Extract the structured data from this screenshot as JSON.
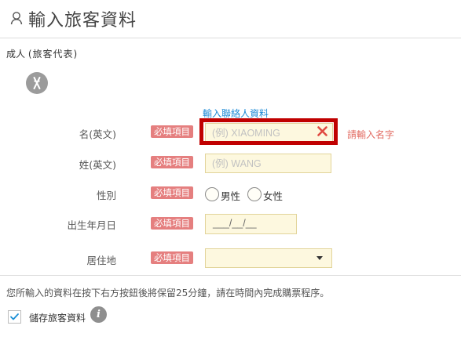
{
  "header": {
    "title": "輸入旅客資料",
    "icon": "person-icon"
  },
  "section": {
    "title": "成人",
    "subtitle": "(旅客代表)"
  },
  "contact_link": "輸入聯絡人資料",
  "required_badge": "必填項目",
  "form": {
    "name_en": {
      "label": "名(英文)",
      "placeholder": "(例) XIAOMING",
      "value": "",
      "error": "請輸入名字"
    },
    "surname_en": {
      "label": "姓(英文)",
      "placeholder": "(例) WANG",
      "value": ""
    },
    "gender": {
      "label": "性別",
      "options": [
        "男性",
        "女性"
      ]
    },
    "birthdate": {
      "label": "出生年月日",
      "value": "___/__/__"
    },
    "residence": {
      "label": "居住地",
      "value": ""
    }
  },
  "notice": "您所輸入的資料在按下右方按鈕後將保留25分鐘，請在時間內完成購票程序。",
  "save": {
    "label": "儲存旅客資料",
    "checked": true,
    "info_icon": "i"
  },
  "colors": {
    "badge": "#e57f7f",
    "error": "#c00000",
    "link": "#1d8ad6",
    "input_bg": "#fdf8df",
    "check": "#1a8fd6"
  }
}
